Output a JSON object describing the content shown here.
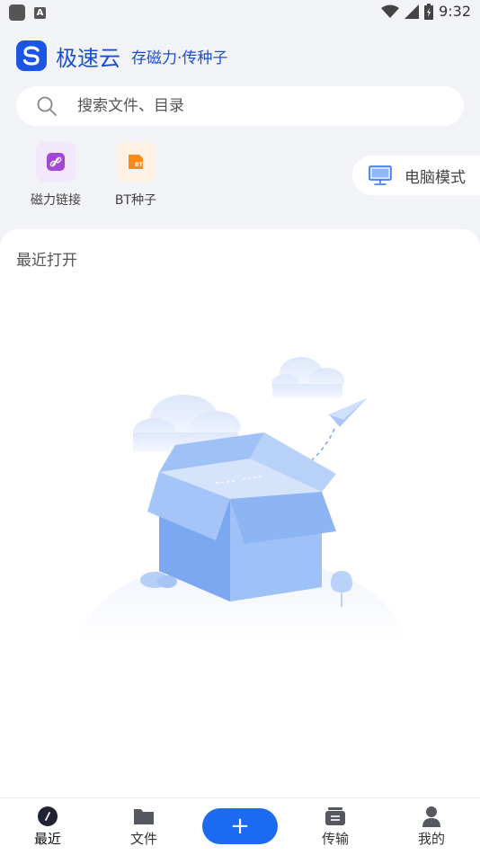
{
  "status_bar": {
    "time": "9:32",
    "icons": [
      "app-square-icon",
      "a-box-icon",
      "wifi-icon",
      "signal-icon",
      "battery-icon"
    ]
  },
  "header": {
    "title": "极速云",
    "subtitle": "存磁力·传种子",
    "logo_letter": "S"
  },
  "search": {
    "placeholder": "搜索文件、目录",
    "value": ""
  },
  "tools": [
    {
      "label": "磁力链接",
      "icon": "magnet-link-icon"
    },
    {
      "label": "BT种子",
      "icon": "bt-torrent-icon"
    }
  ],
  "pc_mode": {
    "label": "电脑模式",
    "icon": "monitor-icon"
  },
  "recent": {
    "title": "最近打开"
  },
  "bottom_nav": {
    "items": [
      {
        "label": "最近",
        "icon": "recent-compass-icon"
      },
      {
        "label": "文件",
        "icon": "folder-icon"
      },
      {
        "label": "传输",
        "icon": "transfer-icon"
      },
      {
        "label": "我的",
        "icon": "person-icon"
      }
    ],
    "fab_label": "+"
  },
  "colors": {
    "accent": "#1c6af0",
    "brand": "#1b4fd1",
    "background": "#f2f3f7"
  }
}
